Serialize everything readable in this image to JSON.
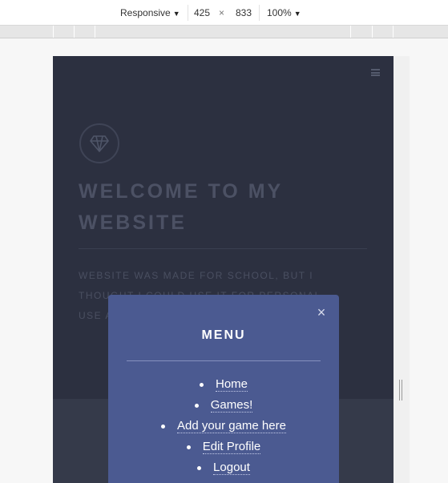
{
  "toolbar": {
    "device_label": "Responsive",
    "width": "425",
    "times": "×",
    "height": "833",
    "zoom": "100%"
  },
  "site": {
    "hero_title": "Welcome to my website",
    "hero_text": "Website was made for school, but I thought I could use it for personal use aswell"
  },
  "menu": {
    "close_symbol": "×",
    "title": "MENU",
    "items": [
      {
        "label": "Home"
      },
      {
        "label": "Games!"
      },
      {
        "label": "Add your game here"
      },
      {
        "label": "Edit Profile"
      },
      {
        "label": "Logout"
      }
    ]
  },
  "colors": {
    "site_background": "#2c3040",
    "menu_background": "#4b5a91"
  }
}
